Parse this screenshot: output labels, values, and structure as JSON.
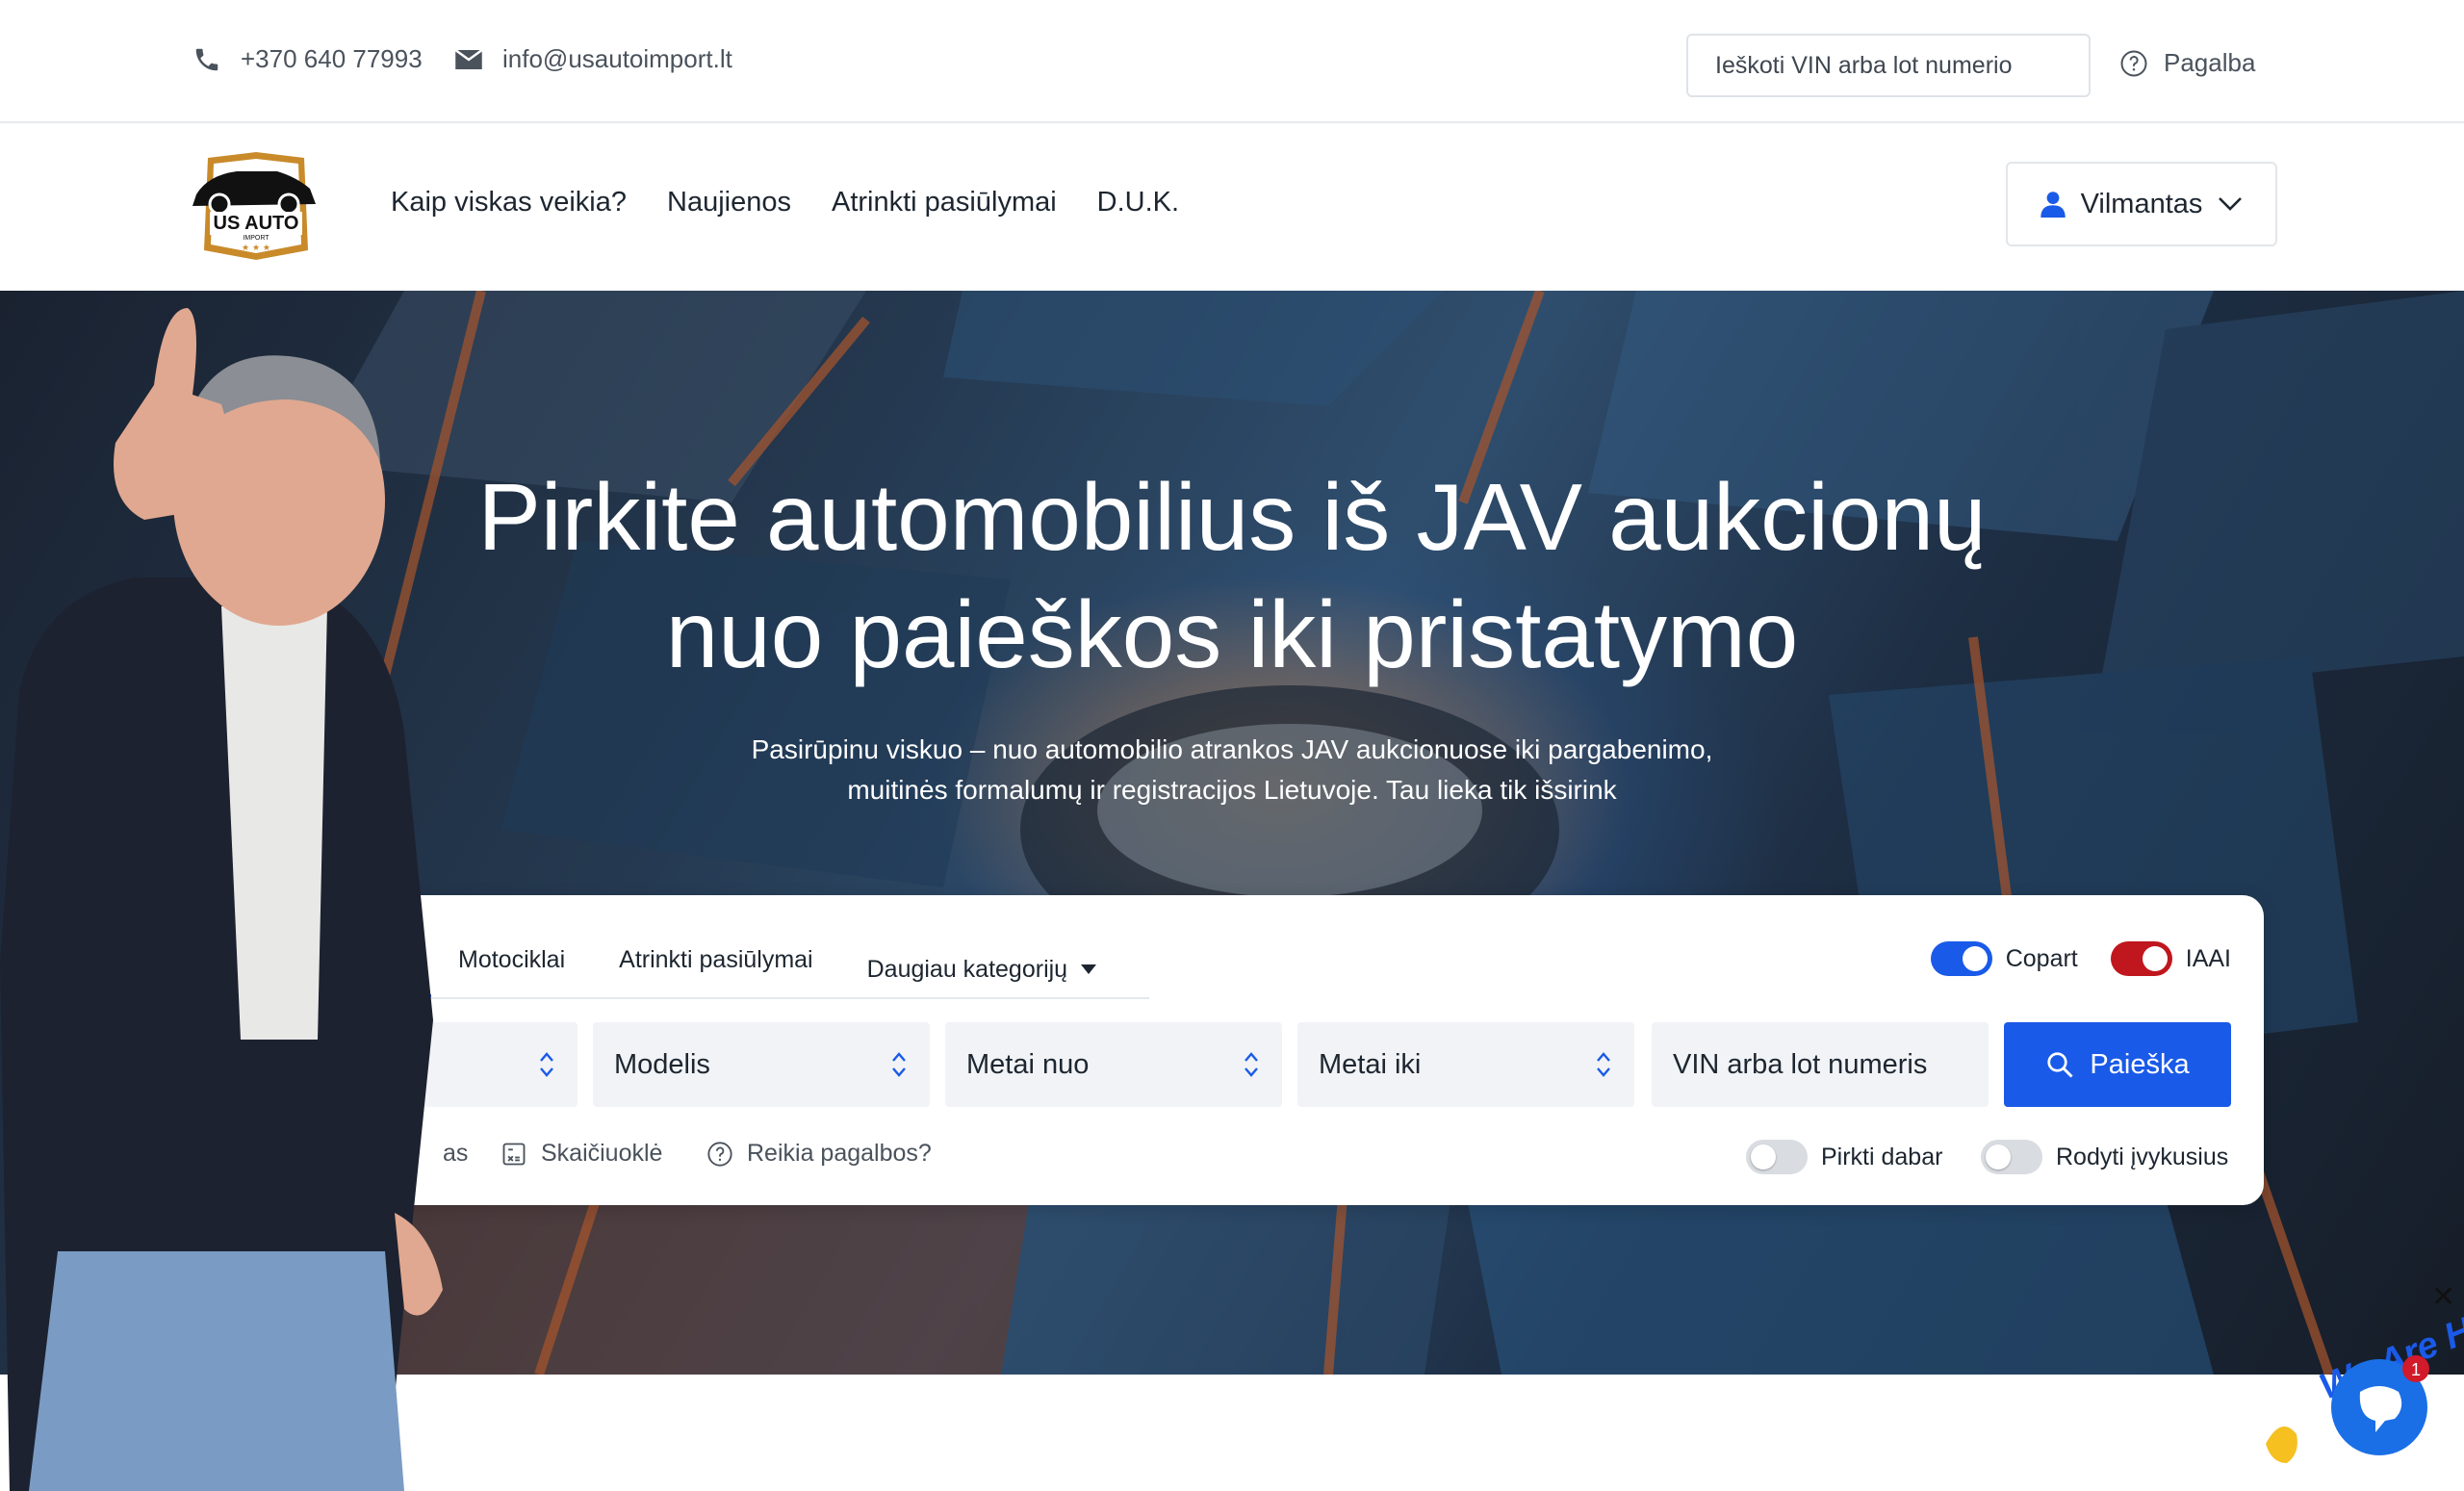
{
  "topbar": {
    "phone": "+370 640 77993",
    "email": "info@usautoimport.lt",
    "vin_search_placeholder": "Ieškoti VIN arba lot numerio",
    "help_label": "Pagalba"
  },
  "nav": {
    "logo_text": "US AUTO",
    "logo_subtext": "IMPORT",
    "links": [
      "Kaip viskas veikia?",
      "Naujienos",
      "Atrinkti pasiūlymai",
      "D.U.K."
    ],
    "user_name": "Vilmantas"
  },
  "hero": {
    "title_line1": "Pirkite automobilius iš JAV aukcionų",
    "title_line2": "nuo paieškos iki pristatymo",
    "subtitle_line1": "Pasirūpinu viskuo – nuo automobilio atrankos JAV aukcionuose iki pargabenimo,",
    "subtitle_line2": "muitinės formalumų ir registracijos Lietuvoje. Tau lieka tik išsirink"
  },
  "search": {
    "tabs": [
      "Motociklai",
      "Atrinkti pasiūlymai",
      "Daugiau kategorijų"
    ],
    "auction_toggles": [
      {
        "label": "Copart",
        "on": true,
        "color": "#1a5ae8"
      },
      {
        "label": "IAAI",
        "on": true,
        "color": "#c0161e"
      }
    ],
    "fields": {
      "model": "Modelis",
      "year_from": "Metai nuo",
      "year_to": "Metai iki",
      "vin_placeholder": "VIN arba lot numeris"
    },
    "search_button": "Paieška",
    "links": {
      "partial": "as",
      "calculator": "Skaičiuoklė",
      "help": "Reikia pagalbos?"
    },
    "option_toggles": [
      {
        "label": "Pirkti dabar",
        "on": false
      },
      {
        "label": "Rodyti įvykusius",
        "on": false
      }
    ]
  },
  "chat": {
    "badge": "1",
    "tagline": "We Are Here!"
  },
  "colors": {
    "primary": "#1a5ae8",
    "iaai": "#c0161e",
    "logo_gold": "#c98a2a"
  }
}
